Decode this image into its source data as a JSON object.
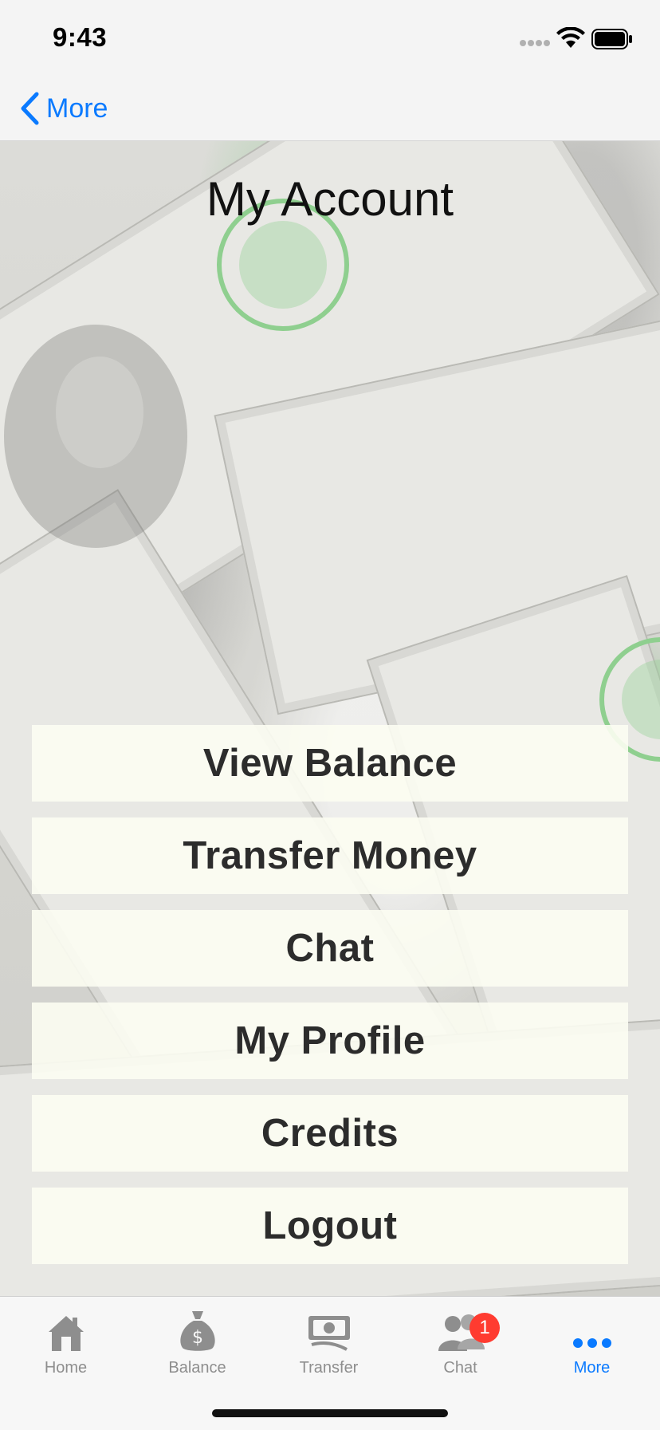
{
  "status_bar": {
    "time": "9:43"
  },
  "nav": {
    "back_label": "More"
  },
  "page": {
    "title": "My Account"
  },
  "menu": {
    "items": [
      {
        "label": "View Balance"
      },
      {
        "label": "Transfer Money"
      },
      {
        "label": "Chat"
      },
      {
        "label": "My Profile"
      },
      {
        "label": "Credits"
      },
      {
        "label": "Logout"
      }
    ]
  },
  "tab_bar": {
    "tabs": [
      {
        "label": "Home",
        "icon": "house-icon"
      },
      {
        "label": "Balance",
        "icon": "money-bag-icon"
      },
      {
        "label": "Transfer",
        "icon": "banknote-icon"
      },
      {
        "label": "Chat",
        "icon": "people-icon",
        "badge": "1"
      },
      {
        "label": "More",
        "icon": "ellipsis-icon",
        "active": true
      }
    ]
  },
  "colors": {
    "accent": "#0a7aff",
    "badge": "#ff3b30",
    "menu_bg": "#fcfdf2"
  }
}
